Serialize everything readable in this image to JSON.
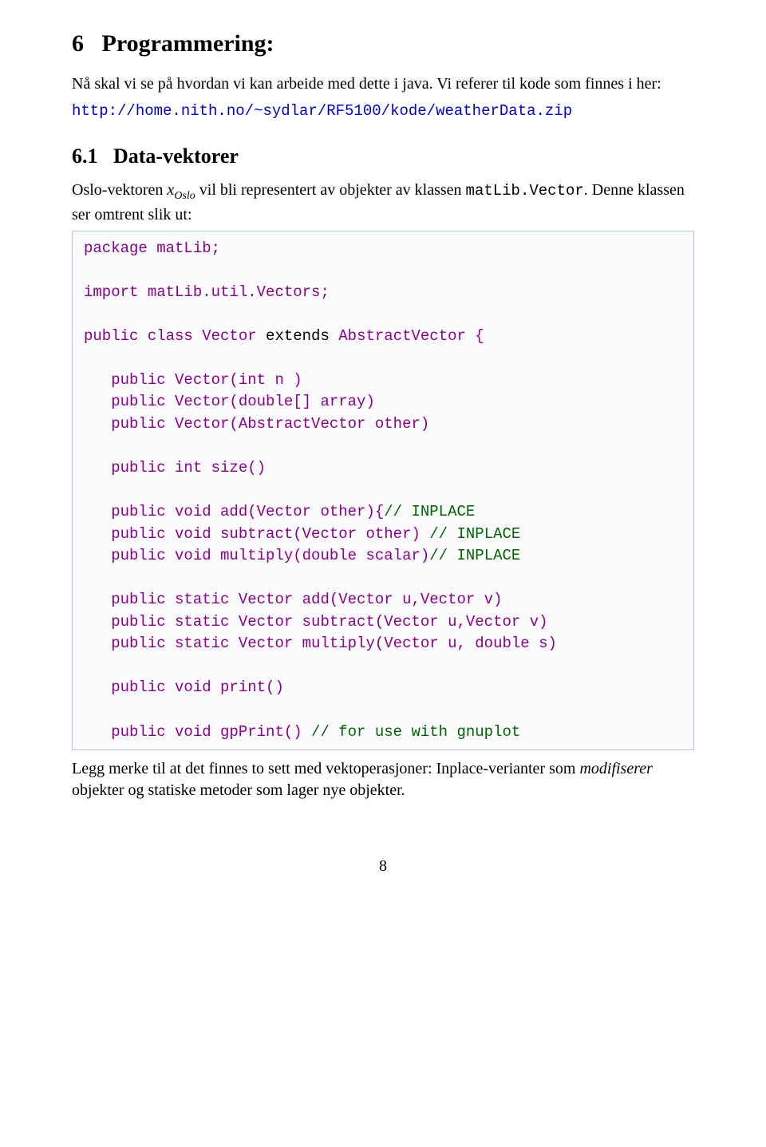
{
  "heading1": "6   Programmering:",
  "intro1": "Nå skal vi se på hvordan vi kan arbeide med dette i java. Vi referer til kode som finnes i her:",
  "url": "http://home.nith.no/~sydlar/RF5100/kode/weatherData.zip",
  "heading2": "6.1   Data-vektorer",
  "intro2a": "Oslo-vektoren ",
  "intro2_var": "x",
  "intro2_sub": "Oslo",
  "intro2b": " vil bli representert av objekter av klassen ",
  "intro2_mono": "matLib.Vector",
  "intro2c": ". Denne klassen ser omtrent slik ut:",
  "code": {
    "l1": "package matLib;",
    "l2": "",
    "l3": "import matLib.util.Vectors;",
    "l4": "",
    "l5a": "public class Vector ",
    "l5b": "extends",
    "l5c": " AbstractVector {",
    "l6": "",
    "l7": "   public Vector(int n )",
    "l8": "   public Vector(double[] array)",
    "l9": "   public Vector(AbstractVector other)",
    "l10": "",
    "l11": "   public int size()",
    "l12": "",
    "l13a": "   public void add(Vector other){",
    "l13c": "// INPLACE",
    "l14a": "   public void subtract(Vector other) ",
    "l14c": "// INPLACE",
    "l15a": "   public void multiply(double scalar)",
    "l15c": "// INPLACE",
    "l16": "",
    "l17": "   public static Vector add(Vector u,Vector v)",
    "l18": "   public static Vector subtract(Vector u,Vector v)",
    "l19": "   public static Vector multiply(Vector u, double s)",
    "l20": "",
    "l21": "   public void print()",
    "l22": "",
    "l23a": "   public void gpPrint() ",
    "l23c": "// for use with gnuplot"
  },
  "outro1": "Legg merke til at det finnes to sett med vektoperasjoner: Inplace-verianter som ",
  "outro_em": "modifiserer",
  "outro2": " objekter og statiske metoder som lager nye objekter.",
  "pagenum": "8"
}
